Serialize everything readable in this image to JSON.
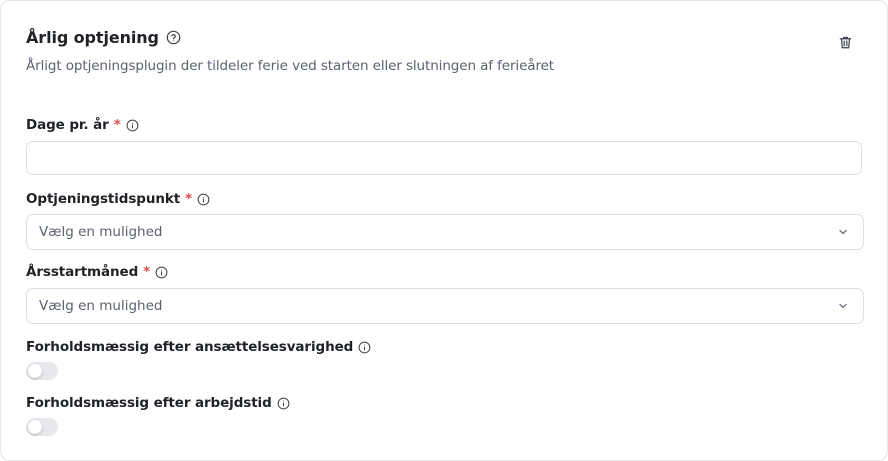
{
  "card": {
    "title": "Årlig optjening",
    "subtitle": "Årligt optjeningsplugin der tildeler ferie ved starten eller slutningen af ferieåret"
  },
  "fields": {
    "days_per_year": {
      "label": "Dage pr. år",
      "required_mark": "*",
      "value": ""
    },
    "accrual_time": {
      "label": "Optjeningstidspunkt",
      "required_mark": "*",
      "selected": "Vælg en mulighed"
    },
    "year_start_month": {
      "label": "Årsstartmåned",
      "required_mark": "*",
      "selected": "Vælg en mulighed"
    },
    "prorate_employment": {
      "label": "Forholdsmæssig efter ansættelsesvarighed",
      "enabled": false
    },
    "prorate_worktime": {
      "label": "Forholdsmæssig efter arbejdstid",
      "enabled": false
    }
  },
  "icons": {
    "help": "help-circle-icon",
    "info": "info-icon",
    "delete": "trash-icon",
    "chevron": "chevron-down-icon"
  },
  "colors": {
    "required": "#e5484d",
    "border": "#dcdfe4",
    "toggle_off": "#e6e8eb"
  }
}
